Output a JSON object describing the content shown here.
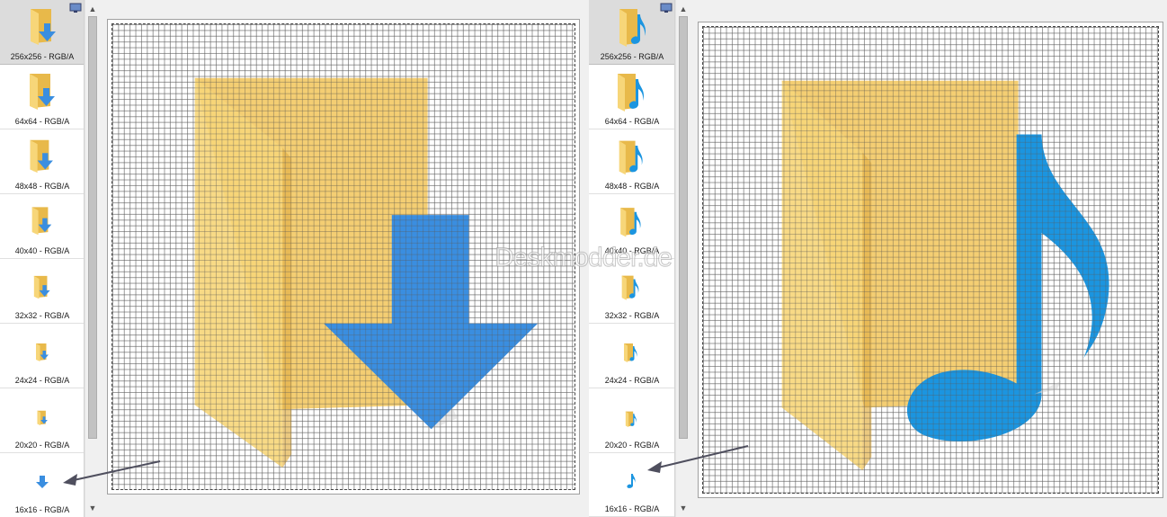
{
  "panel_a": {
    "sizes": [
      {
        "label": "256x256 - RGB/A"
      },
      {
        "label": "64x64 - RGB/A"
      },
      {
        "label": "48x48 - RGB/A"
      },
      {
        "label": "40x40 - RGB/A"
      },
      {
        "label": "32x32 - RGB/A"
      },
      {
        "label": "24x24 - RGB/A"
      },
      {
        "label": "20x20 - RGB/A"
      },
      {
        "label": "16x16 - RGB/A"
      }
    ],
    "overlay_icon": "download-arrow-icon"
  },
  "panel_b": {
    "sizes": [
      {
        "label": "256x256 - RGB/A"
      },
      {
        "label": "64x64 - RGB/A"
      },
      {
        "label": "48x48 - RGB/A"
      },
      {
        "label": "40x40 - RGB/A"
      },
      {
        "label": "32x32 - RGB/A"
      },
      {
        "label": "24x24 - RGB/A"
      },
      {
        "label": "20x20 - RGB/A"
      },
      {
        "label": "16x16 - RGB/A"
      }
    ],
    "overlay_icon": "music-note-icon"
  },
  "watermark": "Deskmodder.de",
  "colors": {
    "folder_front": "#f7d679",
    "folder_back": "#f2c65a",
    "download_blue": "#3a8ee0",
    "music_blue": "#1b95e0",
    "pointer_arrow": "#4f4f5e",
    "selected_bg": "#dcdcdc"
  }
}
